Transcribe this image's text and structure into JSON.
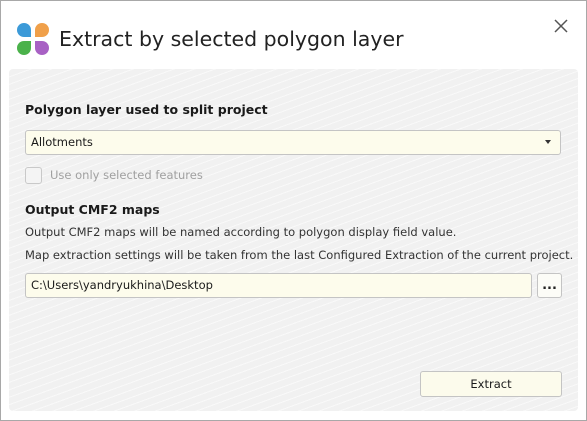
{
  "window": {
    "title": "Extract by selected polygon layer",
    "logo_icon": "app-logo-icon",
    "close_icon": "close-icon"
  },
  "polygon_section": {
    "header": "Polygon layer used to split project",
    "select_value": "Allotments",
    "checkbox_label": "Use only selected features",
    "checkbox_checked": false,
    "checkbox_enabled": false
  },
  "output_section": {
    "header": "Output CMF2 maps",
    "info_line_1": "Output CMF2 maps will be named according to polygon display field value.",
    "info_line_2": "Map extraction settings will be taken from the last Configured Extraction of the current project.",
    "path_value": "C:\\Users\\yandryukhina\\Desktop",
    "browse_label": "..."
  },
  "actions": {
    "extract_label": "Extract"
  },
  "colors": {
    "logo_blue": "#3c9ad8",
    "logo_orange": "#f0a04a",
    "logo_green": "#4bb24b",
    "logo_purple": "#a861c4",
    "input_background": "#fdfcec"
  }
}
